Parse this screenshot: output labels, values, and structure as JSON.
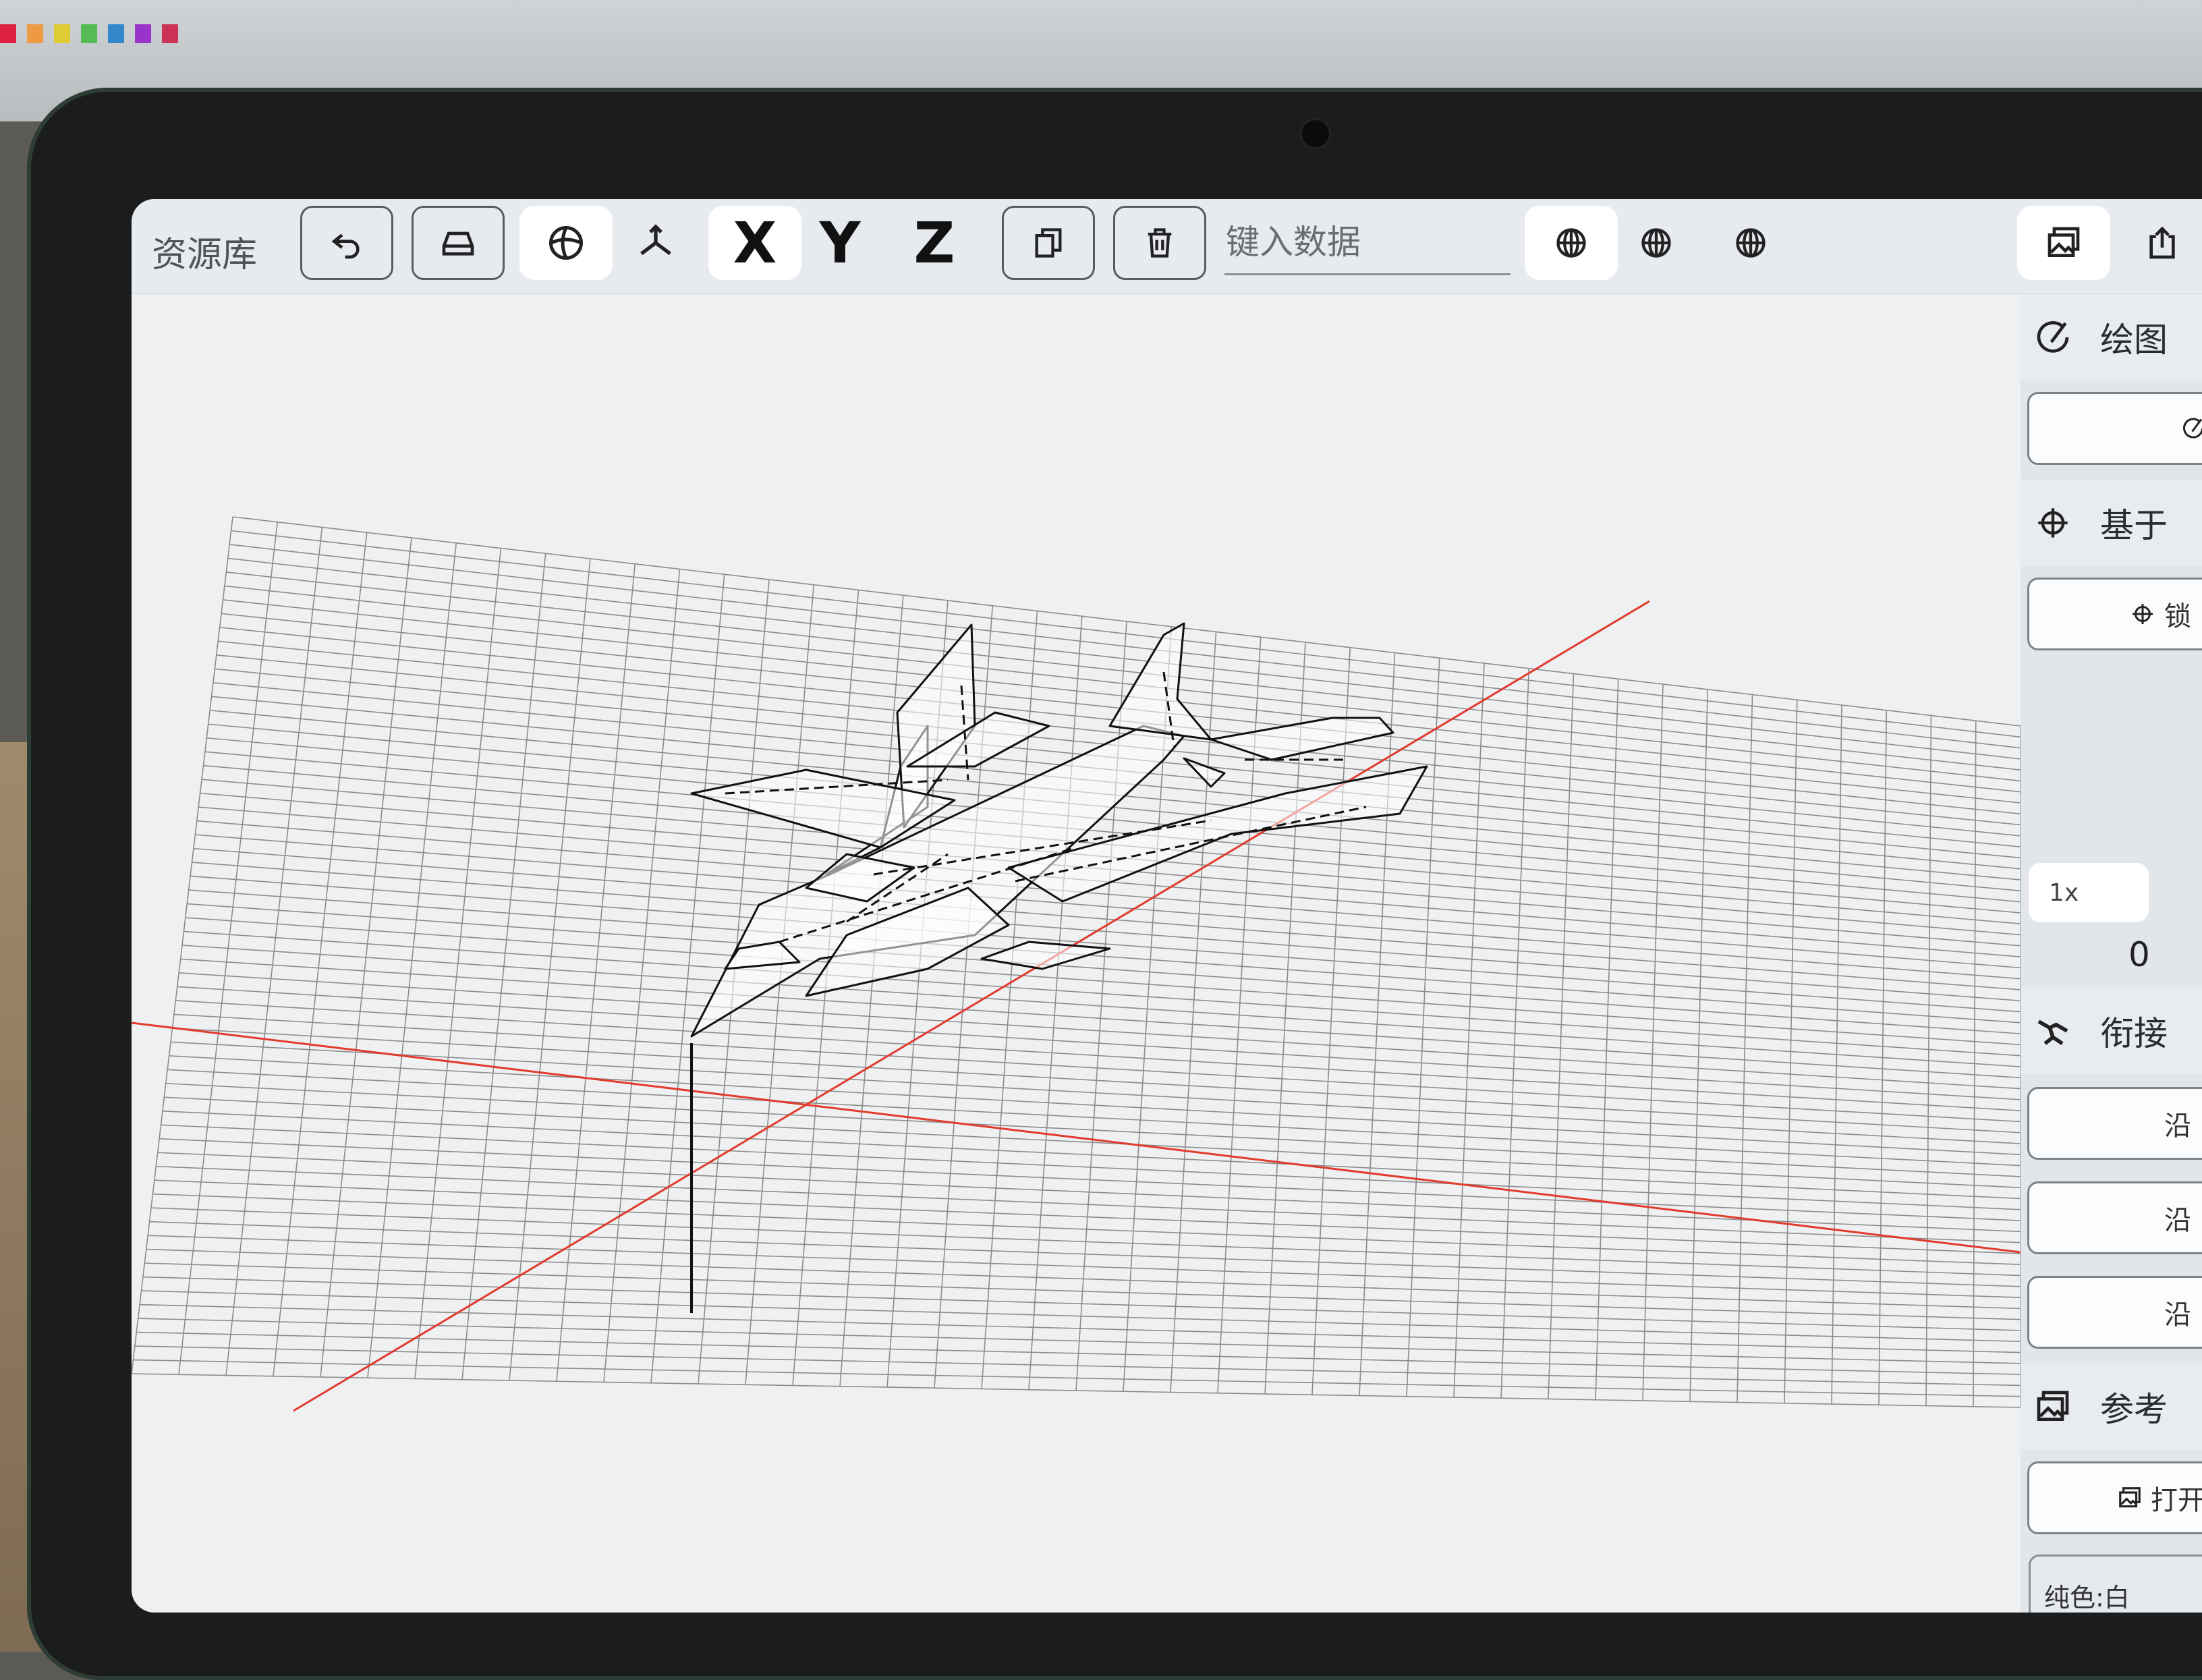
{
  "toolbar": {
    "library_label": "资源库",
    "axis_x": "X",
    "axis_y": "Y",
    "axis_z": "Z",
    "search_placeholder": "键入数据"
  },
  "panel": {
    "drawing_label": "绘图",
    "based_on_label": "基于",
    "lock_label": "锁",
    "zoom": "1x",
    "value": "0",
    "connect_label": "衔接",
    "along_1": "沿",
    "along_2": "沿",
    "along_3": "沿",
    "reference_label": "参考",
    "open_label": "打开",
    "solid_color_label": "纯色:白"
  },
  "colors": {
    "axis_red": "#e23b2e",
    "grid_gray": "#8c8c8c",
    "toolbar_bg": "#e7ebf0"
  },
  "icons": [
    "undo-icon",
    "drive-icon",
    "sphere-icon",
    "axes-icon",
    "copy-icon",
    "trash-icon",
    "globe-icon",
    "image-icon",
    "share-icon",
    "pencil-circle-icon",
    "crosshair-icon",
    "joint-icon"
  ]
}
